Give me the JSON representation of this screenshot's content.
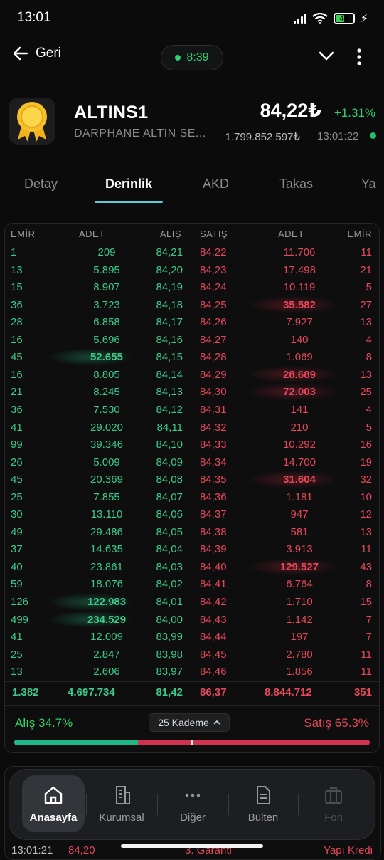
{
  "status": {
    "time": "13:01",
    "battery": "49"
  },
  "header": {
    "back_label": "Geri",
    "timer": "8:39"
  },
  "stock": {
    "symbol": "ALTINS1",
    "name": "DARPHANE ALTIN SE...",
    "price": "84,22₺",
    "change": "+1.31%",
    "volume": "1.799.852.597₺",
    "time": "13:01:22"
  },
  "tabs": [
    "Detay",
    "Derinlik",
    "AKD",
    "Takas",
    "Ya"
  ],
  "book": {
    "headers": {
      "emir_bid": "EMİR",
      "adet_bid": "ADET",
      "alis": "ALIŞ",
      "satis": "SATIŞ",
      "adet_ask": "ADET",
      "emir_ask": "EMİR"
    },
    "rows": [
      {
        "be": "1",
        "ba": "209",
        "bp": "84,21",
        "ap": "84,22",
        "aa": "11.706",
        "ae": "11"
      },
      {
        "be": "13",
        "ba": "5.895",
        "bp": "84,20",
        "ap": "84,23",
        "aa": "17.498",
        "ae": "21"
      },
      {
        "be": "15",
        "ba": "8.907",
        "bp": "84,19",
        "ap": "84,24",
        "aa": "10.119",
        "ae": "5"
      },
      {
        "be": "36",
        "ba": "3.723",
        "bp": "84,18",
        "ap": "84,25",
        "aa": "35.582",
        "ae": "27"
      },
      {
        "be": "28",
        "ba": "6.858",
        "bp": "84,17",
        "ap": "84,26",
        "aa": "7.927",
        "ae": "13"
      },
      {
        "be": "16",
        "ba": "5.696",
        "bp": "84,16",
        "ap": "84,27",
        "aa": "140",
        "ae": "4"
      },
      {
        "be": "45",
        "ba": "52.655",
        "bp": "84,15",
        "ap": "84,28",
        "aa": "1.069",
        "ae": "8"
      },
      {
        "be": "16",
        "ba": "8.805",
        "bp": "84,14",
        "ap": "84,29",
        "aa": "28.689",
        "ae": "13"
      },
      {
        "be": "21",
        "ba": "8.245",
        "bp": "84,13",
        "ap": "84,30",
        "aa": "72.003",
        "ae": "25"
      },
      {
        "be": "36",
        "ba": "7.530",
        "bp": "84,12",
        "ap": "84,31",
        "aa": "141",
        "ae": "4"
      },
      {
        "be": "41",
        "ba": "29.020",
        "bp": "84,11",
        "ap": "84,32",
        "aa": "210",
        "ae": "5"
      },
      {
        "be": "99",
        "ba": "39.346",
        "bp": "84,10",
        "ap": "84,33",
        "aa": "10.292",
        "ae": "16"
      },
      {
        "be": "26",
        "ba": "5.009",
        "bp": "84,09",
        "ap": "84,34",
        "aa": "14.700",
        "ae": "19"
      },
      {
        "be": "45",
        "ba": "20.369",
        "bp": "84,08",
        "ap": "84,35",
        "aa": "31.604",
        "ae": "32"
      },
      {
        "be": "25",
        "ba": "7.855",
        "bp": "84,07",
        "ap": "84,36",
        "aa": "1.181",
        "ae": "10"
      },
      {
        "be": "30",
        "ba": "13.110",
        "bp": "84,06",
        "ap": "84,37",
        "aa": "947",
        "ae": "12"
      },
      {
        "be": "49",
        "ba": "29.486",
        "bp": "84,05",
        "ap": "84,38",
        "aa": "581",
        "ae": "13"
      },
      {
        "be": "37",
        "ba": "14.635",
        "bp": "84,04",
        "ap": "84,39",
        "aa": "3.913",
        "ae": "11"
      },
      {
        "be": "40",
        "ba": "23.861",
        "bp": "84,03",
        "ap": "84,40",
        "aa": "129.527",
        "ae": "43"
      },
      {
        "be": "59",
        "ba": "18.076",
        "bp": "84,02",
        "ap": "84,41",
        "aa": "6.764",
        "ae": "8"
      },
      {
        "be": "126",
        "ba": "122.983",
        "bp": "84,01",
        "ap": "84,42",
        "aa": "1.710",
        "ae": "15"
      },
      {
        "be": "499",
        "ba": "234.529",
        "bp": "84,00",
        "ap": "84,43",
        "aa": "1.142",
        "ae": "7"
      },
      {
        "be": "41",
        "ba": "12.009",
        "bp": "83,99",
        "ap": "84,44",
        "aa": "197",
        "ae": "7"
      },
      {
        "be": "25",
        "ba": "2.847",
        "bp": "83,98",
        "ap": "84,45",
        "aa": "2.780",
        "ae": "11"
      },
      {
        "be": "13",
        "ba": "2.606",
        "bp": "83,97",
        "ap": "84,46",
        "aa": "1.856",
        "ae": "11"
      }
    ],
    "highlight_bid_rows": [
      6,
      20,
      21
    ],
    "highlight_ask_rows": [
      3,
      7,
      8,
      13,
      18
    ],
    "totals": {
      "be": "1.382",
      "ba": "4.697.734",
      "bp": "81,42",
      "ap": "86,37",
      "aa": "8.844.712",
      "ae": "351"
    },
    "alis_label": "Alış 34.7%",
    "satis_label": "Satış 65.3%",
    "kademe_label": "25 Kademe",
    "bid_ratio": 0.347,
    "colors": {
      "bid": "#3cc98a",
      "ask": "#e5485a",
      "accent": "#5fc8d8"
    }
  },
  "under": {
    "time": "13:01:21",
    "price": "84,20",
    "broker": "3. Garanti",
    "broker2": "Yapı Kredi"
  },
  "nav": [
    "Anasayfa",
    "Kurumsal",
    "Diğer",
    "Bülten",
    "Fon"
  ]
}
